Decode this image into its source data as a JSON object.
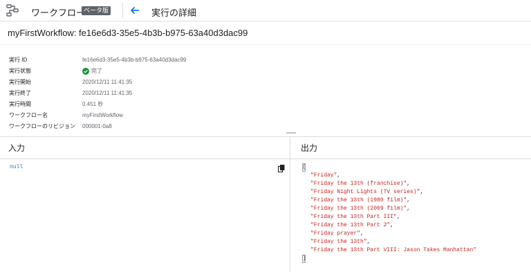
{
  "topbar": {
    "product_title": "ワークフロー",
    "beta_badge": "ベータ版",
    "page_title": "実行の詳細"
  },
  "execution_heading": "myFirstWorkflow: fe16e6d3-35e5-4b3b-b975-63a40d3dac99",
  "details": [
    {
      "label": "実行 ID",
      "value": "fe16e6d3-35e5-4b3b-b975-63a40d3dac99"
    },
    {
      "label": "実行状態",
      "value": "完了"
    },
    {
      "label": "実行開始",
      "value": "2020/12/11 11:41:35"
    },
    {
      "label": "実行終了",
      "value": "2020/12/11 11:41:35"
    },
    {
      "label": "実行時間",
      "value": "0.451 秒"
    },
    {
      "label": "ワークフロー名",
      "value": "myFirstWorkflow"
    },
    {
      "label": "ワークフローのリビジョン",
      "value": "000001-0a8"
    }
  ],
  "input_panel": {
    "title": "入力",
    "value": "null"
  },
  "output_panel": {
    "title": "出力",
    "open_bracket": "[",
    "close_bracket": "]",
    "items": [
      "\"Friday\"",
      "\"Friday the 13th (franchise)\"",
      "\"Friday Night Lights (TV series)\"",
      "\"Friday the 13th (1980 film)\"",
      "\"Friday the 13th (2009 film)\"",
      "\"Friday the 13th Part III\"",
      "\"Friday the 13th Part 2\"",
      "\"Friday prayer\"",
      "\"Friday the 13th\"",
      "\"Friday the 13th Part VIII: Jason Takes Manhattan\""
    ]
  },
  "colors": {
    "accent": "#1a73e8",
    "success": "#1e8e3e",
    "json_string": "#c5221f",
    "badge_bg": "#5f6368"
  },
  "icons": {
    "product": "workflows-icon",
    "back": "arrow-back-icon",
    "status": "check-circle-icon",
    "copy": "copy-icon"
  }
}
